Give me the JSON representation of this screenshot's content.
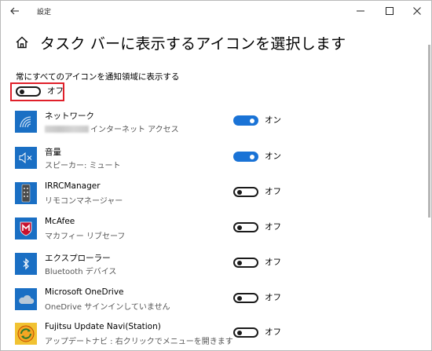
{
  "window": {
    "title": "設定",
    "back_icon": "arrow-left-icon",
    "controls": [
      "minimize-icon",
      "maximize-icon",
      "close-icon"
    ]
  },
  "header": {
    "home_icon": "home-icon",
    "title": "タスク バーに表示するアイコンを選択します"
  },
  "always_show": {
    "label": "常にすべてのアイコンを通知領域に表示する",
    "state": "オフ",
    "on": false,
    "highlight_color": "#e0202a"
  },
  "accent_color": "#1a73d6",
  "apps": [
    {
      "name": "ネットワーク",
      "desc": "インターネット アクセス",
      "desc_has_redacted_prefix": true,
      "state": "オン",
      "on": true,
      "icon": "wifi-icon"
    },
    {
      "name": "音量",
      "desc": "スピーカー: ミュート",
      "state": "オン",
      "on": true,
      "icon": "speaker-muted-icon"
    },
    {
      "name": "IRRCManager",
      "desc": "リモコンマネージャー",
      "state": "オフ",
      "on": false,
      "icon": "remote-control-icon"
    },
    {
      "name": "McAfee",
      "desc": "マカフィー リブセーフ",
      "state": "オフ",
      "on": false,
      "icon": "mcafee-shield-icon"
    },
    {
      "name": "エクスプローラー",
      "desc": "Bluetooth デバイス",
      "state": "オフ",
      "on": false,
      "icon": "bluetooth-icon"
    },
    {
      "name": "Microsoft OneDrive",
      "desc": "OneDrive サインインしていません",
      "state": "オフ",
      "on": false,
      "icon": "cloud-icon"
    },
    {
      "name": "Fujitsu Update Navi(Station)",
      "desc": "アップデートナビ : 右クリックでメニューを開きます",
      "state": "オフ",
      "on": false,
      "icon": "update-navi-icon"
    }
  ]
}
